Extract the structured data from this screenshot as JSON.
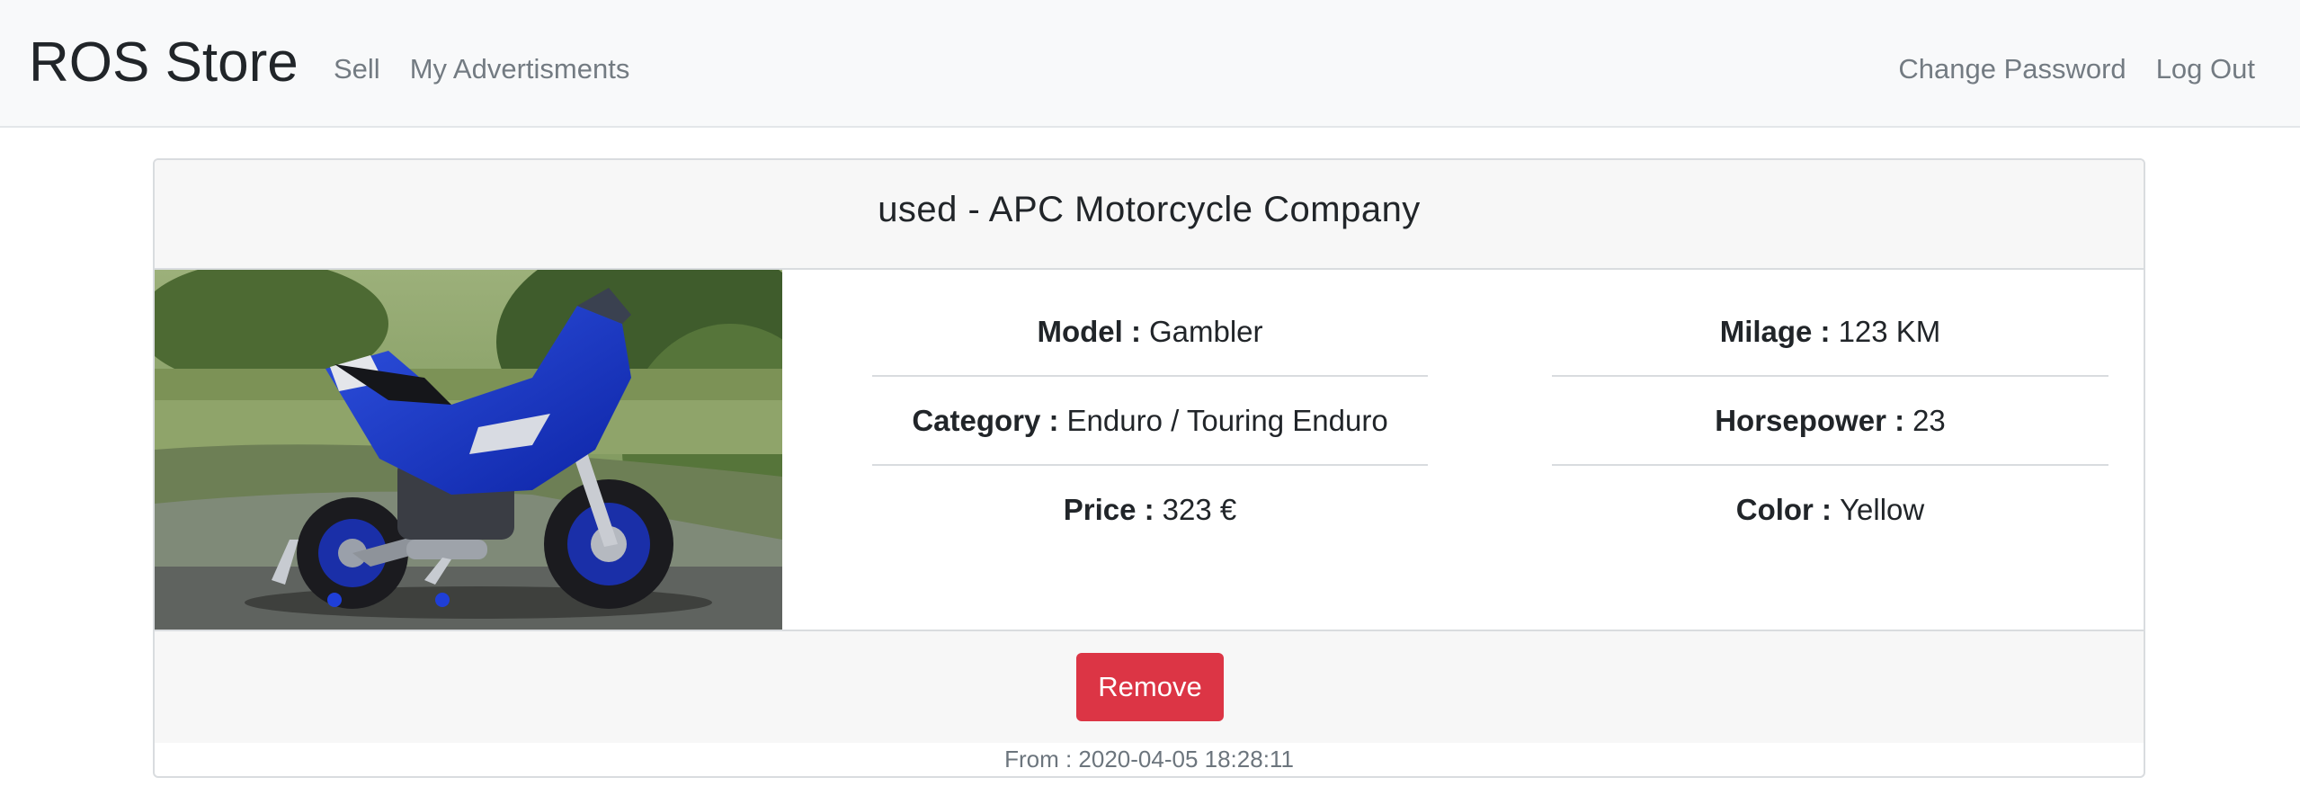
{
  "navbar": {
    "brand": "ROS Store",
    "left_links": [
      "Sell",
      "My Advertisments"
    ],
    "right_links": [
      "Change Password",
      "Log Out"
    ]
  },
  "listing": {
    "title": "used - APC Motorcycle Company",
    "photo_alt": "Blue sport motorcycle on a race track",
    "specs_left": [
      {
        "label": "Model :",
        "value": "Gambler"
      },
      {
        "label": "Category :",
        "value": "Enduro / Touring Enduro"
      },
      {
        "label": "Price :",
        "value": "323 €"
      }
    ],
    "specs_right": [
      {
        "label": "Milage :",
        "value": "123 KM"
      },
      {
        "label": "Horsepower :",
        "value": "23"
      },
      {
        "label": "Color :",
        "value": "Yellow"
      }
    ],
    "remove_label": "Remove",
    "date_text": "From : 2020-04-05 18:28:11"
  },
  "colors": {
    "navbar_bg": "#f8f9fa",
    "danger": "#dc3545",
    "muted_link": "#737b82"
  }
}
